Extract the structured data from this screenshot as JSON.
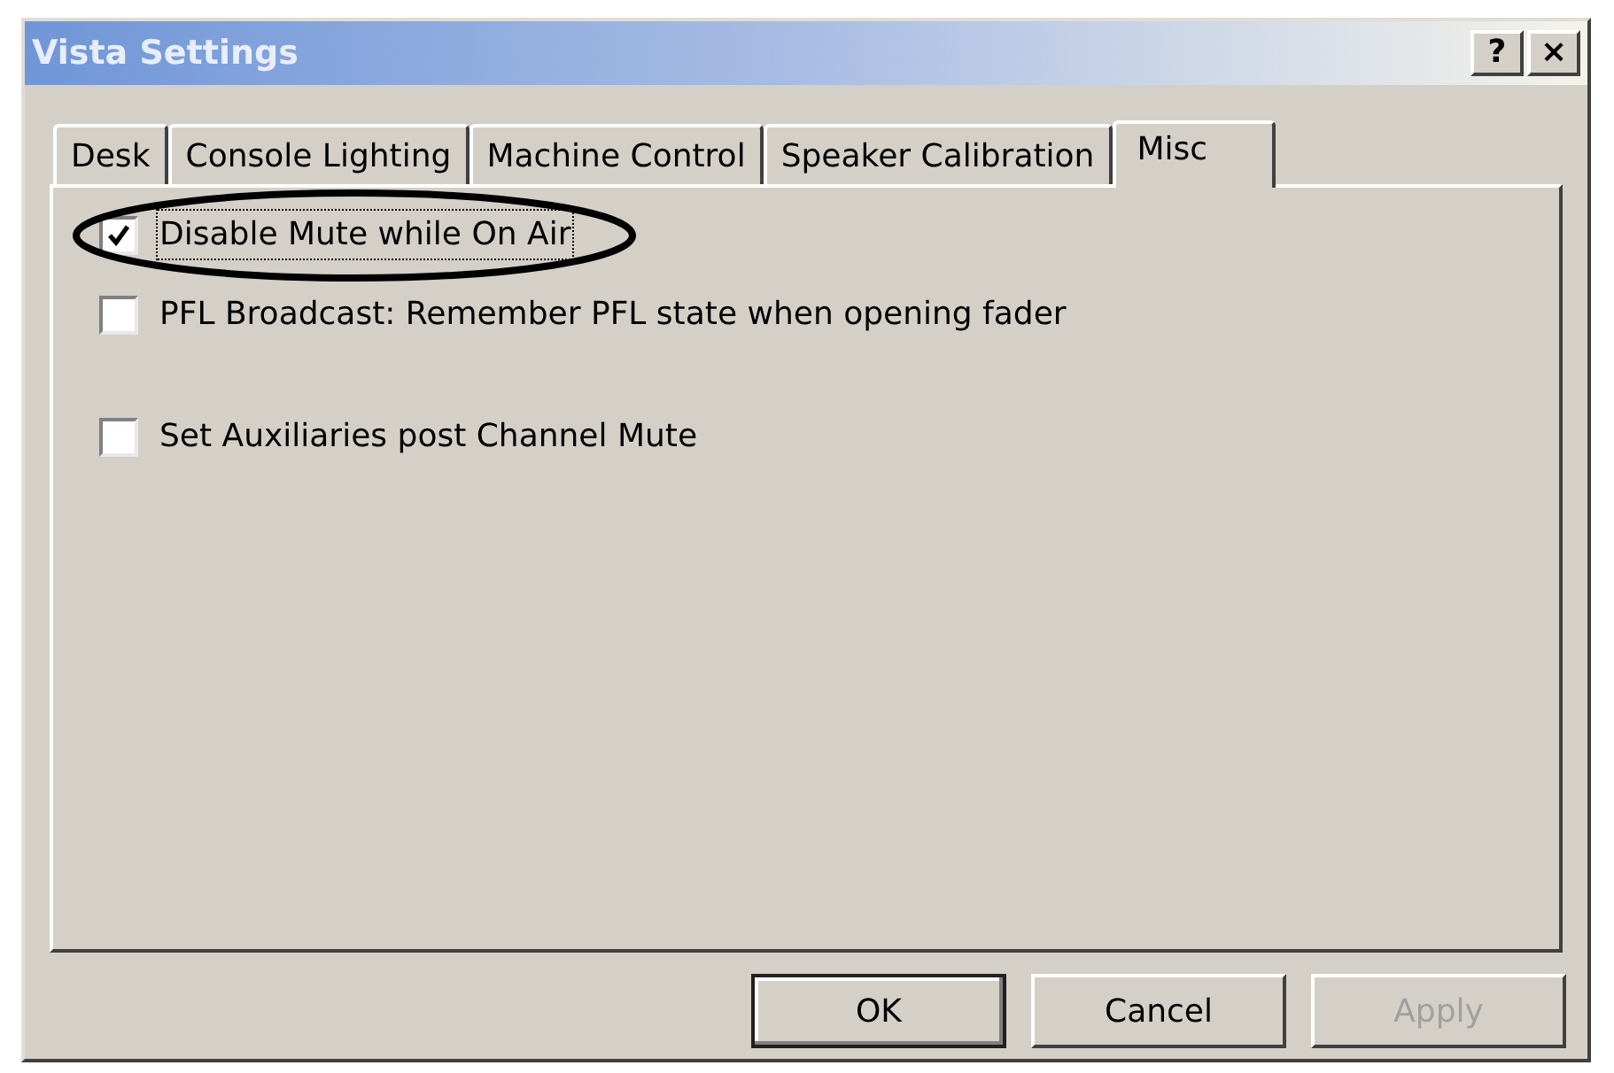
{
  "window": {
    "title": "Vista Settings",
    "title_buttons": [
      "?",
      "×"
    ]
  },
  "tabs": [
    {
      "label": "Desk",
      "selected": false
    },
    {
      "label": "Console Lighting",
      "selected": false
    },
    {
      "label": "Machine Control",
      "selected": false
    },
    {
      "label": "Speaker Calibration",
      "selected": false
    },
    {
      "label": "Misc",
      "selected": true
    }
  ],
  "options": [
    {
      "label": "Disable Mute while On Air",
      "checked": true,
      "focused": true,
      "circled": true
    },
    {
      "label": "PFL Broadcast: Remember PFL state when opening fader",
      "checked": false,
      "focused": false,
      "circled": false
    },
    {
      "label": "Set Auxiliaries post Channel Mute",
      "checked": false,
      "focused": false,
      "circled": false
    }
  ],
  "buttons": [
    {
      "label": "OK",
      "default": true,
      "disabled": false
    },
    {
      "label": "Cancel",
      "default": false,
      "disabled": false
    },
    {
      "label": "Apply",
      "default": false,
      "disabled": true
    }
  ]
}
